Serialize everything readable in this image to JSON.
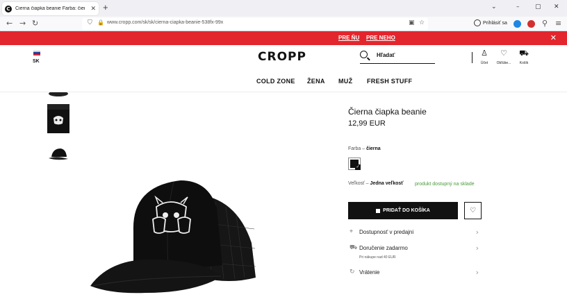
{
  "browser": {
    "tab_title": "Čierna čiapka beanie Farba: čier",
    "tab_favicon": "C",
    "tab_close": "✕",
    "new_tab": "+",
    "url": "www.cropp.com/sk/sk/cierna-ciapka-beanie-538fx-99x",
    "signin_label": "Prihlásiť sa",
    "icons": {
      "back": "←",
      "forward": "→",
      "reload": "↻",
      "shield": "⛉",
      "lock": "🔒",
      "reader": "▣",
      "star": "☆",
      "extensions": "⚲",
      "menu": "≡",
      "win_list": "⌄",
      "win_min": "–",
      "win_max": "▢",
      "win_close": "✕"
    },
    "colors": {
      "ext_blue": "#1e88e5",
      "ext_red": "#d32f2f"
    }
  },
  "promo": {
    "link_1": "PRE ŇU",
    "link_2": "PRE NEHO",
    "close": "✕",
    "background": "#e3262d"
  },
  "header": {
    "country": "SK",
    "logo": "CROPP",
    "search_placeholder": "Hľadať",
    "icons": [
      {
        "glyph": "♙",
        "label": "Účet"
      },
      {
        "glyph": "♡",
        "label": "Obľúbe..."
      },
      {
        "glyph": "⛟",
        "label": "Košík"
      }
    ]
  },
  "nav": [
    "COLD ZONE",
    "ŽENA",
    "MUŽ",
    "FRESH STUFF"
  ],
  "product": {
    "title": "Čierna čiapka beanie",
    "price": "12,99 EUR",
    "color_label": "Farba –",
    "color_value": "čierna",
    "size_label": "Veľkosť –",
    "size_value": "Jedna veľkosť",
    "stock": "produkt dostupný na sklade",
    "add_to_cart": "PRIDAŤ DO KOŠÍKA",
    "wishlist_icon": "♡",
    "info": [
      {
        "icon": "⌖",
        "label": "Dostupnosť v predajni",
        "chevron": "›"
      },
      {
        "icon": "⛟",
        "label": "Doručenie zadarmo",
        "chevron": "›",
        "sub": "Pri nákupe nad 40 EUR"
      },
      {
        "icon": "↻",
        "label": "Vrátenie",
        "chevron": "›"
      }
    ]
  }
}
